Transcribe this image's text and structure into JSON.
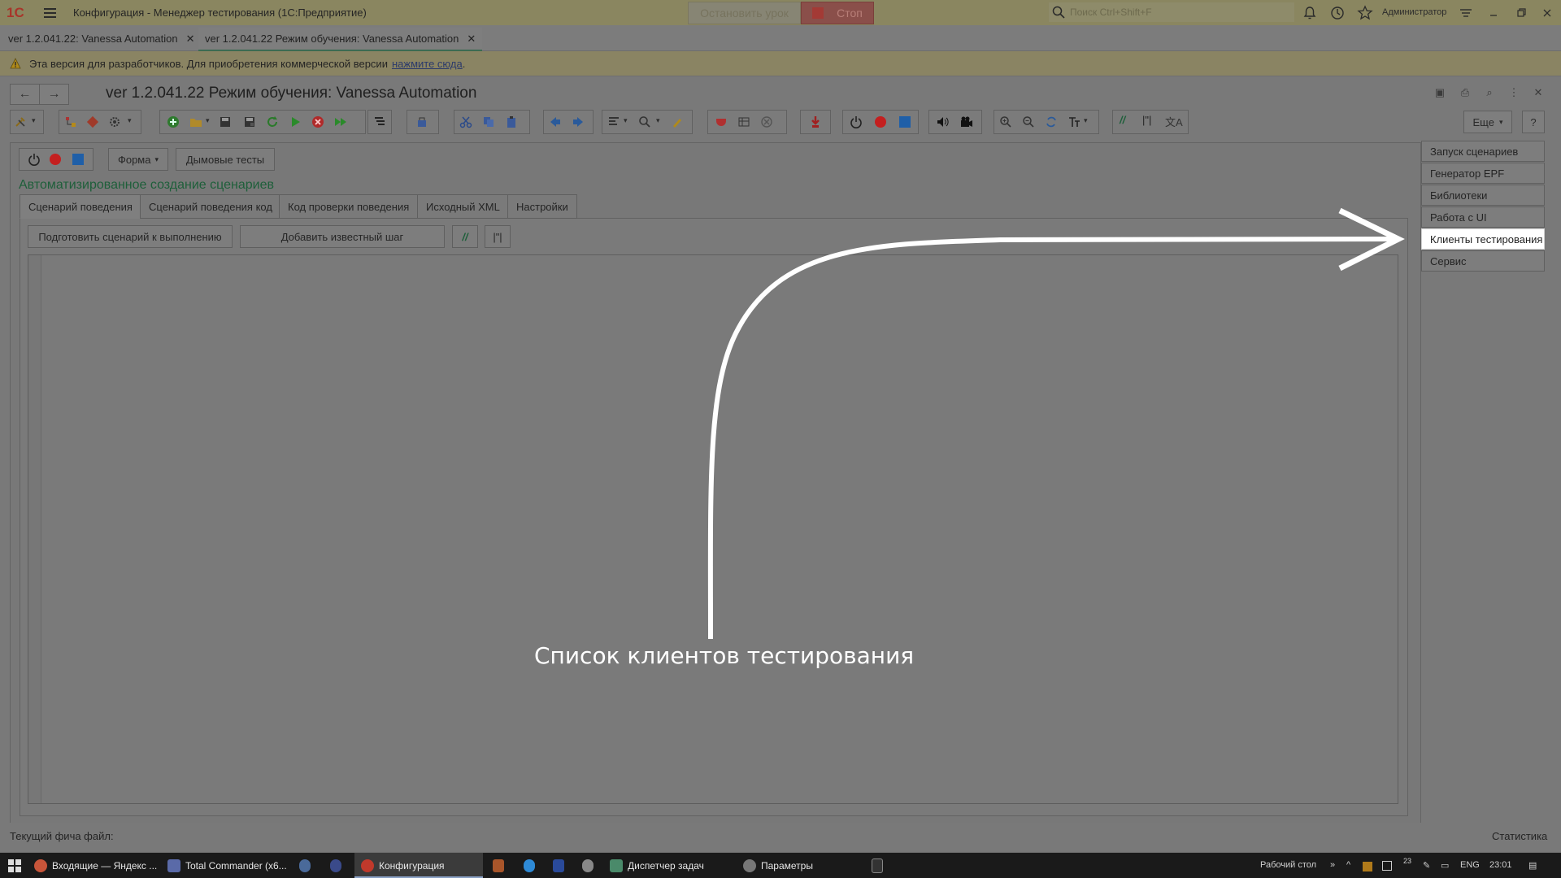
{
  "window": {
    "title": "Конфигурация  - Менеджер тестирования (1С:Предприятие)",
    "logo_text": "1С",
    "stop_lesson_label": "Остановить урок",
    "stop_label": "Стоп",
    "search_placeholder": "Поиск Ctrl+Shift+F",
    "user": "Администратор"
  },
  "open_tabs": [
    {
      "label": "ver 1.2.041.22: Vanessa Automation"
    },
    {
      "label": "ver 1.2.041.22 Режим обучения: Vanessa Automation"
    }
  ],
  "warning": {
    "text": "Эта версия для разработчиков. Для приобретения коммерческой версии",
    "link": "нажмите сюда",
    "link_suffix": "."
  },
  "form": {
    "title": "ver 1.2.041.22 Режим обучения: Vanessa Automation",
    "more_label": "Еще",
    "help_label": "?",
    "form_button": "Форма",
    "smoke_tests_button": "Дымовые тесты",
    "group_title": "Автоматизированное создание сценариев",
    "tabs": [
      {
        "label": "Сценарий поведения"
      },
      {
        "label": "Сценарий поведения код"
      },
      {
        "label": "Код проверки поведения"
      },
      {
        "label": "Исходный XML"
      },
      {
        "label": "Настройки"
      }
    ],
    "prepare_button": "Подготовить сценарий к выполнению",
    "add_step_button": "Добавить известный шаг",
    "comment_button": "//",
    "quote_button": "|\"|"
  },
  "right_panel": {
    "items": [
      {
        "label": "Запуск сценариев"
      },
      {
        "label": "Генератор EPF"
      },
      {
        "label": "Библиотеки"
      },
      {
        "label": "Работа с UI"
      },
      {
        "label": "Клиенты тестирования"
      },
      {
        "label": "Сервис"
      }
    ],
    "active_index": 4
  },
  "status": {
    "current_file": "Текущий фича файл:",
    "statistics": "Статистика"
  },
  "annotation": {
    "label": "Список клиентов тестирования",
    "color": "#ffffff"
  },
  "taskbar": {
    "items": [
      {
        "label": "Входящие — Яндекс ..."
      },
      {
        "label": "Total Commander (x6..."
      },
      {
        "label": "Конфигурация"
      },
      {
        "label": "Диспетчер задач"
      },
      {
        "label": "Параметры"
      }
    ],
    "desktop_label": "Рабочий стол",
    "lang": "ENG",
    "time": "23:01",
    "tray_count": "23"
  },
  "colors": {
    "accent_green": "#1e5f3a",
    "stop_red": "#a33a35",
    "record_red": "#c41f1f",
    "blue_square": "#1f5fa8"
  }
}
